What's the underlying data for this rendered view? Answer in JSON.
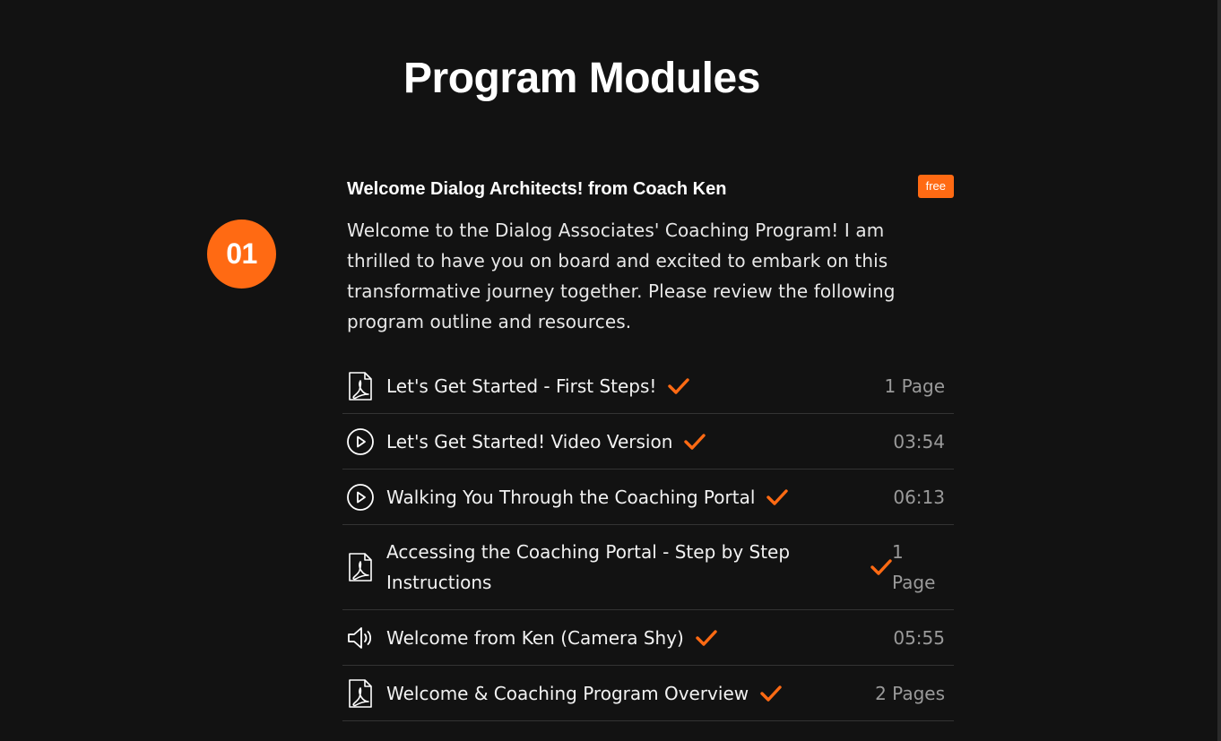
{
  "page": {
    "title": "Program Modules"
  },
  "module": {
    "number": "01",
    "title": "Welcome Dialog Architects! from Coach Ken",
    "badge": "free",
    "description": "Welcome to the Dialog Associates' Coaching Program! I am thrilled to have you on board and excited to embark on this transformative journey together. Please review the following program outline and resources.",
    "lessons": [
      {
        "title": "Let's Get Started - First Steps!",
        "meta": "1 Page",
        "icon": "pdf-icon",
        "completed": true
      },
      {
        "title": "Let's Get Started! Video Version",
        "meta": "03:54",
        "icon": "play-icon",
        "completed": true
      },
      {
        "title": "Walking You Through the Coaching Portal",
        "meta": "06:13",
        "icon": "play-icon",
        "completed": true
      },
      {
        "title": "Accessing the Coaching Portal - Step by Step Instructions",
        "meta": "1 Page",
        "icon": "pdf-icon",
        "completed": true
      },
      {
        "title": "Welcome from Ken (Camera Shy)",
        "meta": "05:55",
        "icon": "audio-icon",
        "completed": true
      },
      {
        "title": "Welcome & Coaching Program Overview",
        "meta": "2 Pages",
        "icon": "pdf-icon",
        "completed": true
      }
    ]
  },
  "colors": {
    "accent": "#ff6a13",
    "background": "#121212",
    "text": "#ffffff",
    "muted": "#9a9a9a",
    "divider": "#333333"
  }
}
